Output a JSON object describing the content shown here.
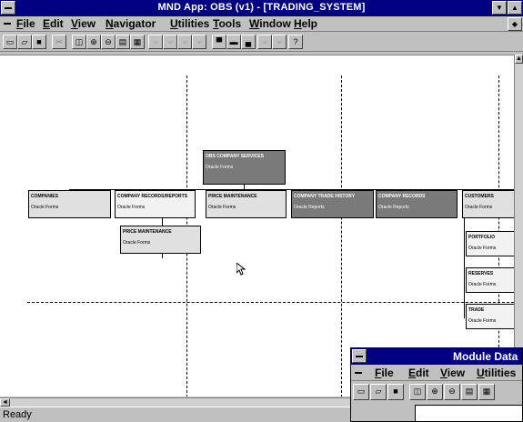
{
  "window": {
    "title": "MND App: OBS (v1) - [TRADING_SYSTEM]"
  },
  "menubar": {
    "items": [
      "File",
      "Edit",
      "View",
      "Navigator",
      "Utilities",
      "Tools",
      "Window",
      "Help"
    ]
  },
  "toolbar": {
    "buttons": [
      "new",
      "open",
      "save",
      "cut",
      "copy",
      "zoom-in",
      "zoom-out",
      "fit",
      "grid",
      "b1",
      "b2",
      "b3",
      "b4",
      "align-a",
      "align-b",
      "align-c",
      "b5",
      "b6",
      "help"
    ]
  },
  "diagram": {
    "root": {
      "title": "OBS COMPANY SERVICES",
      "subtitle": "Oracle Forms"
    },
    "nodes": [
      {
        "title": "COMPANIES",
        "subtitle": "Oracle Forms"
      },
      {
        "title": "COMPANY RECORDS/REPORTS",
        "subtitle": "Oracle Forms"
      },
      {
        "title": "PRICE MAINTENANCE",
        "subtitle": "Oracle Forms"
      },
      {
        "title": "COMPANY TRADE HISTORY",
        "subtitle": "Oracle Reports"
      },
      {
        "title": "COMPANY RECORDS",
        "subtitle": "Oracle Reports"
      },
      {
        "title": "CUSTOMERS",
        "subtitle": "Oracle Forms"
      }
    ],
    "child_price": {
      "title": "PRICE MAINTENANCE",
      "subtitle": "Oracle Forms"
    },
    "customer_children": [
      {
        "title": "PORTFOLIO",
        "subtitle": "Oracle Forms"
      },
      {
        "title": "RESERVES",
        "subtitle": "Oracle Forms"
      },
      {
        "title": "TRADE",
        "subtitle": "Oracle Forms"
      }
    ]
  },
  "status": {
    "text": "Ready"
  },
  "module_window": {
    "title": "Module Data",
    "menu": [
      "File",
      "Edit",
      "View",
      "Utilities"
    ]
  }
}
